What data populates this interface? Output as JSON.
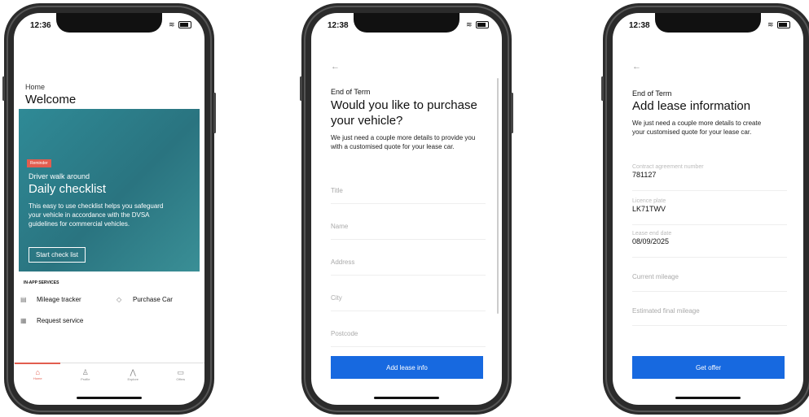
{
  "phone1": {
    "status_time": "12:36",
    "breadcrumb": "Home",
    "title": "Welcome",
    "hero": {
      "badge": "Reminder",
      "subtitle": "Driver walk around",
      "title": "Daily checklist",
      "description": "This easy to use checklist helps you safeguard your vehicle in accordance with the DVSA guidelines for commercial vehicles.",
      "button": "Start check list"
    },
    "services_heading": "IN-APP SERVICES",
    "services": [
      {
        "label": "Mileage tracker",
        "icon": "odometer-icon"
      },
      {
        "label": "Purchase Car",
        "icon": "tag-icon"
      },
      {
        "label": "Request service",
        "icon": "calendar-icon"
      }
    ],
    "tabs": [
      {
        "label": "Home",
        "icon": "home-icon"
      },
      {
        "label": "Profile",
        "icon": "profile-icon"
      },
      {
        "label": "Explore",
        "icon": "explore-icon"
      },
      {
        "label": "Offers",
        "icon": "offers-icon"
      }
    ],
    "accent": "#e25d4f",
    "hero_color": "#2f8a96"
  },
  "phone2": {
    "status_time": "12:38",
    "back": "←",
    "eyebrow": "End of Term",
    "title": "Would you like to purchase your vehicle?",
    "description": "We just need a couple more details to provide you with a customised quote for your lease car.",
    "fields": [
      {
        "placeholder": "Title"
      },
      {
        "placeholder": "Name"
      },
      {
        "placeholder": "Address"
      },
      {
        "placeholder": "City"
      },
      {
        "placeholder": "Postcode"
      }
    ],
    "button": "Add lease info",
    "button_color": "#1769e0"
  },
  "phone3": {
    "status_time": "12:38",
    "back": "←",
    "eyebrow": "End of Term",
    "title": "Add lease information",
    "description": "We just need a couple more details to create your customised quote for your lease car.",
    "fields": [
      {
        "label": "Contract agreement number",
        "value": "781127"
      },
      {
        "label": "Licence plate",
        "value": "LK71TWV"
      },
      {
        "label": "Lease end date",
        "value": "08/09/2025"
      },
      {
        "label": "",
        "value": "",
        "placeholder": "Current mileage"
      },
      {
        "label": "",
        "value": "",
        "placeholder": "Estimated final mileage"
      }
    ],
    "button": "Get offer",
    "button_color": "#1769e0"
  }
}
